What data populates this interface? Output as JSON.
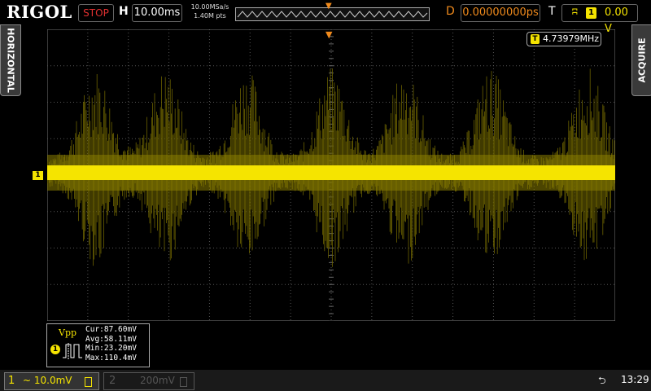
{
  "top": {
    "brand": "RIGOL",
    "run_state": "STOP",
    "horizontal_label": "H",
    "timebase": "10.00ms",
    "sample_rate": "10.00MSa/s",
    "memory_points": "1.40M pts",
    "delay_label": "D",
    "delay": "0.00000000ps",
    "trigger_label": "T",
    "trigger_source": "1",
    "trigger_level": "0.00 V"
  },
  "side": {
    "left_tab": "HORIZONTAL",
    "right_tab": "ACQUIRE"
  },
  "screen": {
    "frequency_counter": "4.73979MHz",
    "counter_icon": "T",
    "channel_marker": "1",
    "trace_color": "#f5e400",
    "trigger_color": "#f08a1c"
  },
  "measurement": {
    "name": "Vpp",
    "channel": "1",
    "cur": "Cur:87.60mV",
    "avg": "Avg:58.11mV",
    "min": "Min:23.20mV",
    "max": "Max:110.4mV"
  },
  "bottom": {
    "ch1_num": "1",
    "ch1_scale": "~ 10.0mV",
    "ch2_num": "2",
    "ch2_scale": "200mV",
    "clock": "13:29"
  },
  "icons": {
    "usb": "usb-icon",
    "trigger_marker": "trigger-position-icon",
    "edge": "rising-edge-icon"
  }
}
